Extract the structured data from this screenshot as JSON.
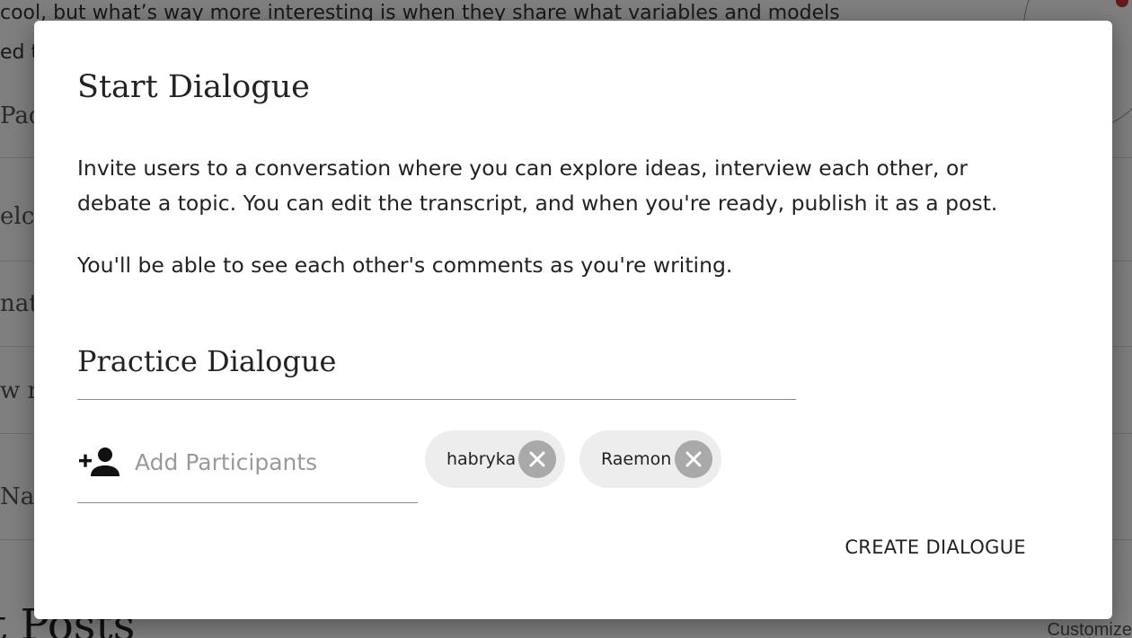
{
  "background": {
    "line1": "cool, but what’s way more interesting is when they share what variables and models",
    "line2": "ed t",
    "fragments": [
      "Pac",
      "elco",
      "nat",
      "w r",
      "Na"
    ],
    "heading": "t Posts",
    "customize": "Customize"
  },
  "dialog": {
    "title": "Start Dialogue",
    "description": "Invite users to a conversation where you can explore ideas, interview each other, or debate a topic. You can edit the transcript, and when you're ready, publish it as a post.",
    "note": "You'll be able to see each other's comments as you're writing.",
    "dialogue_title_value": "Practice Dialogue",
    "participants": {
      "icon": "add-person-icon",
      "placeholder": "Add Participants",
      "selected": [
        {
          "name": "habryka",
          "remove_icon": "remove-circle-icon"
        },
        {
          "name": "Raemon",
          "remove_icon": "remove-circle-icon"
        }
      ]
    },
    "create_label": "CREATE DIALOGUE"
  },
  "colors": {
    "overlay": "rgba(0,0,0,0.5)",
    "chip_background": "#ededed",
    "chip_remove": "#a9a9a9",
    "text": "#222222",
    "placeholder": "#9a9a9a"
  }
}
